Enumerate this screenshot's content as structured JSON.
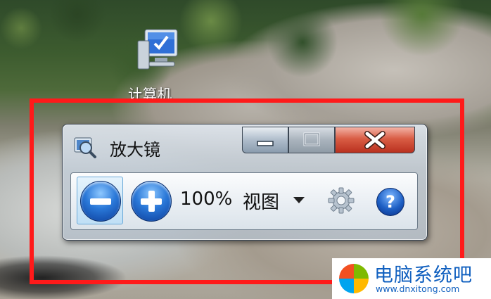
{
  "desktop": {
    "icon_label": "计算机"
  },
  "window": {
    "title": "放大镜",
    "caption_buttons": {
      "minimize_icon": "minimize-icon",
      "maximize_icon": "maximize-icon",
      "close_icon": "close-icon"
    },
    "accent_color": "#2a78d8",
    "close_color": "#c8412a"
  },
  "toolbar": {
    "zoom_out_icon": "minus-icon",
    "zoom_in_icon": "plus-icon",
    "zoom_level": "100%",
    "view_label": "视图",
    "settings_icon": "gear-icon",
    "help_label": "?"
  },
  "highlight": {
    "color": "#ff1a1a"
  },
  "watermark": {
    "name": "电脑系统吧",
    "url": "www.dnxitong.com"
  }
}
